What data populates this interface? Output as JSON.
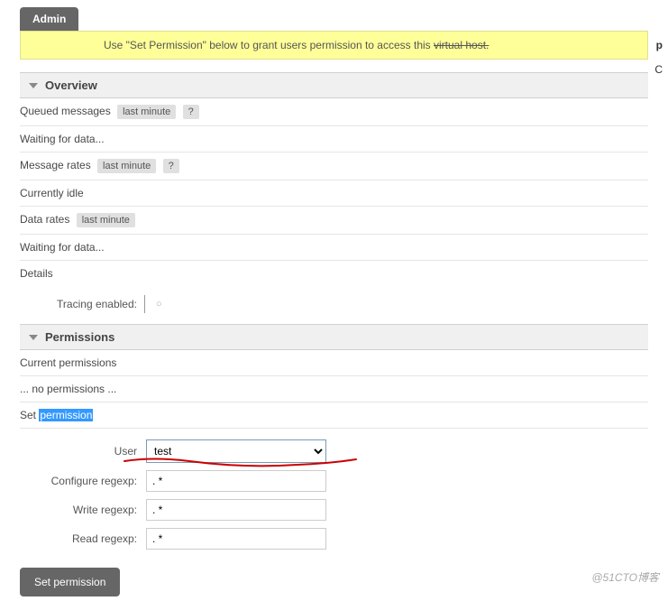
{
  "tab": {
    "admin_label": "Admin"
  },
  "notice": {
    "text_1": "Use \"Set Permission\" below to grant users permission to access this ",
    "text_2": "virtual host."
  },
  "sections": {
    "overview_title": "Overview",
    "permissions_title": "Permissions"
  },
  "overview": {
    "queued_label": "Queued messages",
    "pill_last_minute": "last minute",
    "help_q": "?",
    "waiting_1": "Waiting for data...",
    "message_rates_label": "Message rates",
    "currently_idle": "Currently idle",
    "data_rates_label": "Data rates",
    "waiting_2": "Waiting for data...",
    "details_label": "Details",
    "tracing_label": "Tracing enabled:",
    "tracing_value": "○"
  },
  "permissions": {
    "current_label": "Current permissions",
    "no_permissions": "... no permissions ...",
    "set_prefix": "Set ",
    "set_highlight": "permission",
    "form": {
      "user_label": "User",
      "user_value": "test",
      "configure_label": "Configure regexp:",
      "configure_value": ". *",
      "write_label": "Write regexp:",
      "write_value": ". *",
      "read_label": "Read regexp:",
      "read_value": ". *"
    },
    "button_label": "Set permission"
  },
  "right_edge": {
    "p": "p",
    "c": "C"
  },
  "watermark": "@51CTO博客"
}
